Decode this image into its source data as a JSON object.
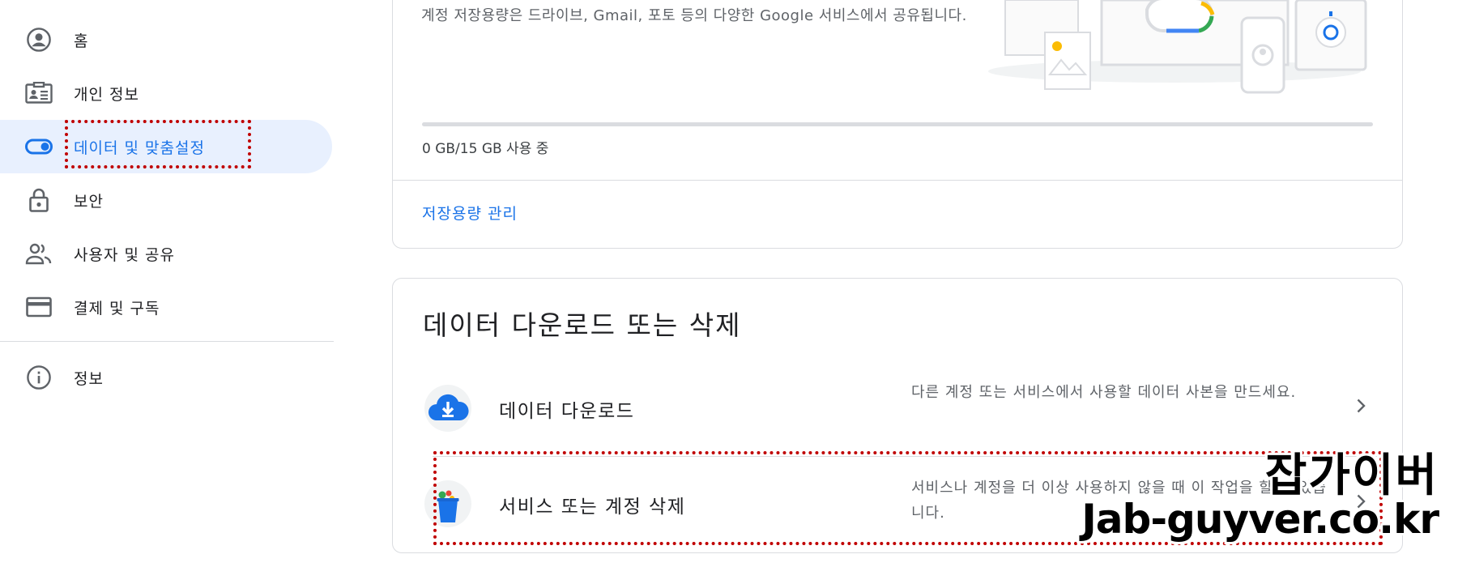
{
  "sidebar": {
    "items": [
      {
        "label": "홈",
        "icon": "account-circle-icon"
      },
      {
        "label": "개인 정보",
        "icon": "id-card-icon"
      },
      {
        "label": "데이터 및 맞춤설정",
        "icon": "toggle-icon"
      },
      {
        "label": "보안",
        "icon": "lock-icon"
      },
      {
        "label": "사용자 및 공유",
        "icon": "people-icon"
      },
      {
        "label": "결제 및 구독",
        "icon": "credit-card-icon"
      },
      {
        "label": "정보",
        "icon": "info-icon"
      }
    ],
    "active_index": 2
  },
  "storage": {
    "description": "계정 저장용량은 드라이브, Gmail, 포토 등의 다양한 Google 서비스에서 공유됩니다.",
    "usage": "0 GB/15 GB 사용 중",
    "used_fraction": 0,
    "manage_link": "저장용량 관리"
  },
  "download_delete": {
    "title": "데이터 다운로드 또는 삭제",
    "rows": [
      {
        "title": "데이터 다운로드",
        "description": "다른 계정 또는 서비스에서 사용할 데이터 사본을 만드세요.",
        "icon": "cloud-download-icon"
      },
      {
        "title": "서비스 또는 계정 삭제",
        "description": "서비스나 계정을 더 이상 사용하지 않을 때 이 작업을 할 수 있습니다.",
        "icon": "trash-bin-icon"
      }
    ]
  },
  "watermark": {
    "line1": "잡가이버",
    "line2": "Jab-guyver.co.kr"
  },
  "colors": {
    "accent": "#1a73e8",
    "active_bg": "#e8f0fe",
    "highlight_box": "#c00000"
  }
}
